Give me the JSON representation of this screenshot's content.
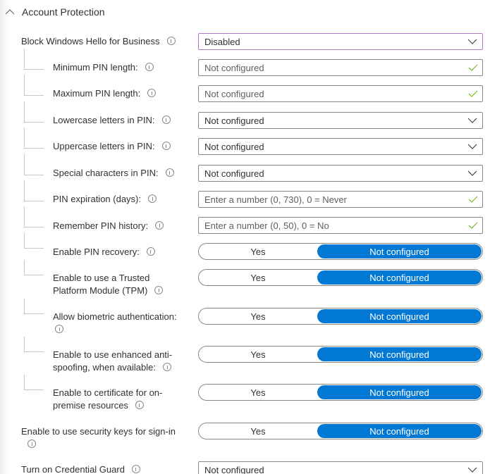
{
  "section": {
    "title": "Account Protection",
    "icon": "chevron-up-icon"
  },
  "settings": [
    {
      "label": "Block Windows Hello for Business",
      "type": "dropdown",
      "value": "Disabled",
      "focused": true
    },
    {
      "label": "Minimum PIN length:",
      "type": "text",
      "value": "Not configured"
    },
    {
      "label": "Maximum PIN length:",
      "type": "text",
      "value": "Not configured"
    },
    {
      "label": "Lowercase letters in PIN:",
      "type": "dropdown",
      "value": "Not configured"
    },
    {
      "label": "Uppercase letters in PIN:",
      "type": "dropdown",
      "value": "Not configured"
    },
    {
      "label": "Special characters in PIN:",
      "type": "dropdown",
      "value": "Not configured"
    },
    {
      "label": "PIN expiration (days):",
      "type": "text",
      "placeholder": "Enter a number (0, 730), 0 = Never"
    },
    {
      "label": "Remember PIN history:",
      "type": "text",
      "placeholder": "Enter a number (0, 50), 0 = No"
    },
    {
      "label": "Enable PIN recovery:",
      "type": "toggle",
      "options": [
        "Yes",
        "Not configured"
      ],
      "selected": "Not configured"
    },
    {
      "label_line1": "Enable to use a Trusted",
      "label_line2": "Platform Module (TPM)",
      "type": "toggle",
      "options": [
        "Yes",
        "Not configured"
      ],
      "selected": "Not configured"
    },
    {
      "label": "Allow biometric authentication:",
      "type": "toggle",
      "options": [
        "Yes",
        "Not configured"
      ],
      "selected": "Not configured"
    },
    {
      "label_line1": "Enable to use enhanced anti-",
      "label_line2": "spoofing, when available:",
      "type": "toggle",
      "options": [
        "Yes",
        "Not configured"
      ],
      "selected": "Not configured"
    },
    {
      "label_line1": "Enable to certificate for on-",
      "label_line2": "premise resources",
      "type": "toggle",
      "options": [
        "Yes",
        "Not configured"
      ],
      "selected": "Not configured"
    },
    {
      "label": "Enable to use security keys for sign-in",
      "type": "toggle",
      "options": [
        "Yes",
        "Not configured"
      ],
      "selected": "Not configured"
    },
    {
      "label": "Turn on Credential Guard",
      "type": "dropdown",
      "value": "Not configured"
    }
  ],
  "colors": {
    "accent": "#0078d4",
    "focus_border": "#b47ac7",
    "valid_check": "#6bb700",
    "border": "#8a8886"
  }
}
